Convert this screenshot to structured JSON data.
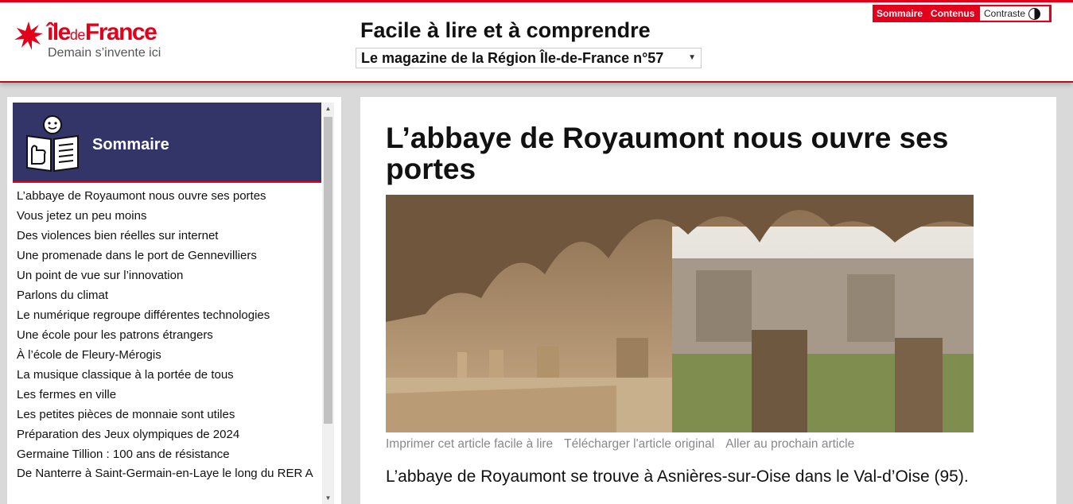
{
  "header": {
    "logo": {
      "word_prefix": "île",
      "word_middle": "de",
      "word_suffix": "France",
      "tagline": "Demain s’invente ici"
    },
    "title": "Facile à lire et à comprendre",
    "issue_select": "Le magazine de la Région Île-de-France n°57",
    "nav": {
      "sommaire": "Sommaire",
      "contenus": "Contenus",
      "contraste": "Contraste"
    }
  },
  "sidebar": {
    "title": "Sommaire",
    "items": [
      "L’abbaye de Royaumont nous ouvre ses portes",
      "Vous jetez un peu moins",
      "Des violences bien réelles sur internet",
      "Une promenade dans le port de Gennevilliers",
      "Un point de vue sur l’innovation",
      "Parlons du climat",
      "Le numérique regroupe différentes technologies",
      "Une école pour les patrons étrangers",
      "À l’école de Fleury-Mérogis",
      "La musique classique à la portée de tous",
      "Les fermes en ville",
      "Les petites pièces de monnaie sont utiles",
      "Préparation des Jeux olympiques de 2024",
      "Germaine Tillion : 100 ans de résistance",
      "De Nanterre à Saint-Germain-en-Laye le long du RER A"
    ]
  },
  "article": {
    "title": "L’abbaye de Royaumont nous ouvre ses portes",
    "links": {
      "print": "Imprimer cet article facile à lire",
      "download": "Télécharger l'article original",
      "next": "Aller au prochain article"
    },
    "intro": "L’abbaye de Royaumont se trouve à Asnières-sur-Oise dans le Val-d’Oise (95)."
  },
  "colors": {
    "brand_red": "#e3001b",
    "sommaire_band": "#333468",
    "page_bg": "#d9d9d9"
  }
}
